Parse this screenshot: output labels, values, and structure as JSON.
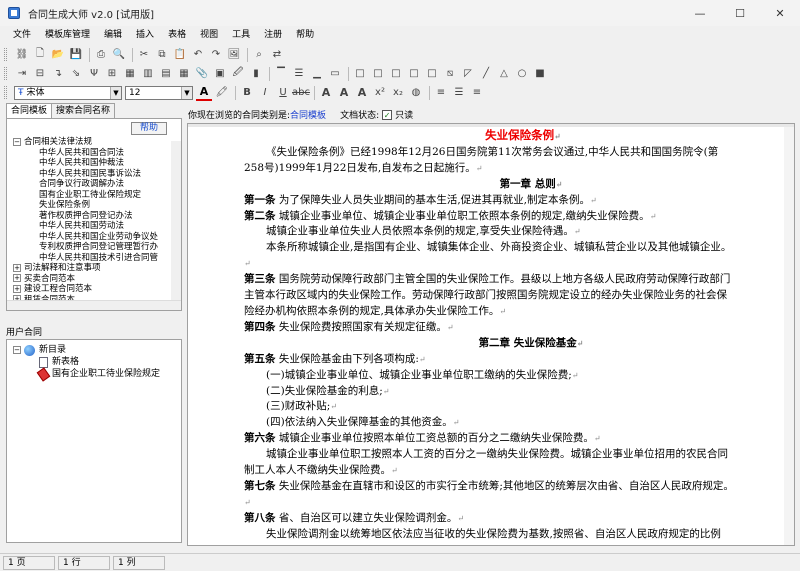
{
  "window": {
    "title": "合同生成大师 v2.0 [试用版]",
    "min": "—",
    "max": "☐",
    "close": "✕"
  },
  "menu": [
    "文件",
    "模板库管理",
    "编辑",
    "插入",
    "表格",
    "视图",
    "工具",
    "注册",
    "帮助"
  ],
  "format_bar": {
    "style": "宋体",
    "size": "12"
  },
  "left_tabs": [
    "合同模板",
    "搜索合同名称"
  ],
  "help_label": "帮助",
  "tree": [
    {
      "label": "合同相关法律法规",
      "level": 0,
      "exp": "−"
    },
    {
      "label": "中华人民共和国合同法",
      "level": 1
    },
    {
      "label": "中华人民共和国仲裁法",
      "level": 1
    },
    {
      "label": "中华人民共和国民事诉讼法",
      "level": 1
    },
    {
      "label": "合同争议行政调解办法",
      "level": 1
    },
    {
      "label": "国有企业职工待业保险规定",
      "level": 1
    },
    {
      "label": "失业保险条例",
      "level": 1
    },
    {
      "label": "著作权质押合同登记办法",
      "level": 1
    },
    {
      "label": "中华人民共和国劳动法",
      "level": 1
    },
    {
      "label": "中华人民共和国企业劳动争议处",
      "level": 1
    },
    {
      "label": "专利权质押合同登记管理暂行办",
      "level": 1
    },
    {
      "label": "中华人民共和国技术引进合同管",
      "level": 1
    },
    {
      "label": "司法解释和注意事项",
      "level": 0,
      "exp": "+"
    },
    {
      "label": "买卖合同范本",
      "level": 0,
      "exp": "+"
    },
    {
      "label": "建设工程合同范本",
      "level": 0,
      "exp": "+"
    },
    {
      "label": "租赁合同范本",
      "level": 0,
      "exp": "+"
    }
  ],
  "user_contracts_label": "用户合同",
  "user_tree": {
    "root": "新目录",
    "items": [
      "新表格",
      "国有企业职工待业保险规定"
    ]
  },
  "info": {
    "prefix": "你现在浏览的合同类别是:",
    "category": "合同模板",
    "status_label": "文档状态:",
    "status_value": "只读"
  },
  "doc": {
    "title": "失业保险条例",
    "intro": "《失业保险条例》已经1998年12月26日国务院第11次常务会议通过,中华人民共和国国务院令(第258号)1999年1月22日发布,自发布之日起施行。",
    "ch1": "第一章 总则",
    "a1_head": "第一条",
    "a1": "为了保障失业人员失业期间的基本生活,促进其再就业,制定本条例。",
    "a2_head": "第二条",
    "a2": "城镇企业事业单位、城镇企业事业单位职工依照本条例的规定,缴纳失业保险费。",
    "a2_p2": "城镇企业事业单位失业人员依照本条例的规定,享受失业保险待遇。",
    "a2_p3": "本条所称城镇企业,是指国有企业、城镇集体企业、外商投资企业、城镇私营企业以及其他城镇企业。",
    "a3_head": "第三条",
    "a3": "国务院劳动保障行政部门主管全国的失业保险工作。县级以上地方各级人民政府劳动保障行政部门主管本行政区域内的失业保险工作。劳动保障行政部门按照国务院规定设立的经办失业保险业务的社会保险经办机构依照本条例的规定,具体承办失业保险工作。",
    "a4_head": "第四条",
    "a4": "失业保险费按照国家有关规定征缴。",
    "ch2": "第二章 失业保险基金",
    "a5_head": "第五条",
    "a5": "失业保险基金由下列各项构成:",
    "a5_i1": "(一)城镇企业事业单位、城镇企业事业单位职工缴纳的失业保险费;",
    "a5_i2": "(二)失业保险基金的利息;",
    "a5_i3": "(三)财政补贴;",
    "a5_i4": "(四)依法纳入失业保障基金的其他资金。",
    "a6_head": "第六条",
    "a6": "城镇企业事业单位按照本单位工资总额的百分之二缴纳失业保险费。",
    "a6_p2": "城镇企业事业单位职工按照本人工资的百分之一缴纳失业保险费。城镇企业事业单位招用的农民合同制工人本人不缴纳失业保险费。",
    "a7_head": "第七条",
    "a7": "失业保险基金在直辖市和设区的市实行全市统筹;其他地区的统筹层次由省、自治区人民政府规定。",
    "a8_head": "第八条",
    "a8": "省、自治区可以建立失业保险调剂金。",
    "a8_p2": "失业保险调剂金以统筹地区依法应当征收的失业保险费为基数,按照省、自治区人民政府规定的比例"
  },
  "statusbar": [
    "1 页",
    "1 行",
    "1 列"
  ]
}
